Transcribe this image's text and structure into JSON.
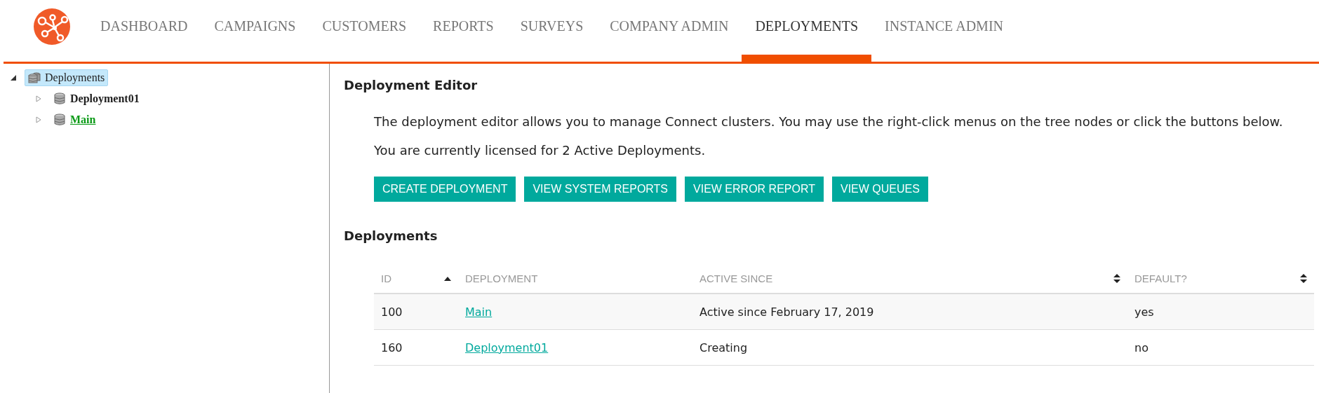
{
  "nav": {
    "tabs": [
      {
        "label": "DASHBOARD",
        "selected": false
      },
      {
        "label": "CAMPAIGNS",
        "selected": false
      },
      {
        "label": "CUSTOMERS",
        "selected": false
      },
      {
        "label": "REPORTS",
        "selected": false
      },
      {
        "label": "SURVEYS",
        "selected": false
      },
      {
        "label": "COMPANY ADMIN",
        "selected": false
      },
      {
        "label": "DEPLOYMENTS",
        "selected": true
      },
      {
        "label": "INSTANCE ADMIN",
        "selected": false
      }
    ]
  },
  "tree": {
    "label": "Deployments",
    "expanded": true,
    "selected": true,
    "children": [
      {
        "label": "Deployment01",
        "expanded": false,
        "active": false
      },
      {
        "label": "Main",
        "expanded": false,
        "active": true
      }
    ]
  },
  "editor": {
    "title": "Deployment Editor",
    "intro": "The deployment editor allows you to manage Connect clusters. You may use the right-click menus on the tree nodes or click the buttons below.",
    "license": "You are currently licensed for 2 Active Deployments.",
    "buttons": [
      "CREATE DEPLOYMENT",
      "VIEW SYSTEM REPORTS",
      "VIEW ERROR REPORT",
      "VIEW QUEUES"
    ]
  },
  "deployments": {
    "title": "Deployments",
    "columns": [
      {
        "label": "ID",
        "sortable": true,
        "sorted_ascending": true
      },
      {
        "label": "DEPLOYMENT",
        "sortable": false
      },
      {
        "label": "ACTIVE SINCE",
        "sortable": true,
        "sorted_ascending": false
      },
      {
        "label": "DEFAULT?",
        "sortable": true,
        "sorted_ascending": false
      }
    ],
    "rows": [
      {
        "id": "100",
        "deployment": "Main",
        "active_since": "Active since February 17, 2019",
        "default": "yes"
      },
      {
        "id": "160",
        "deployment": "Deployment01",
        "active_since": "Creating",
        "default": "no"
      }
    ]
  }
}
